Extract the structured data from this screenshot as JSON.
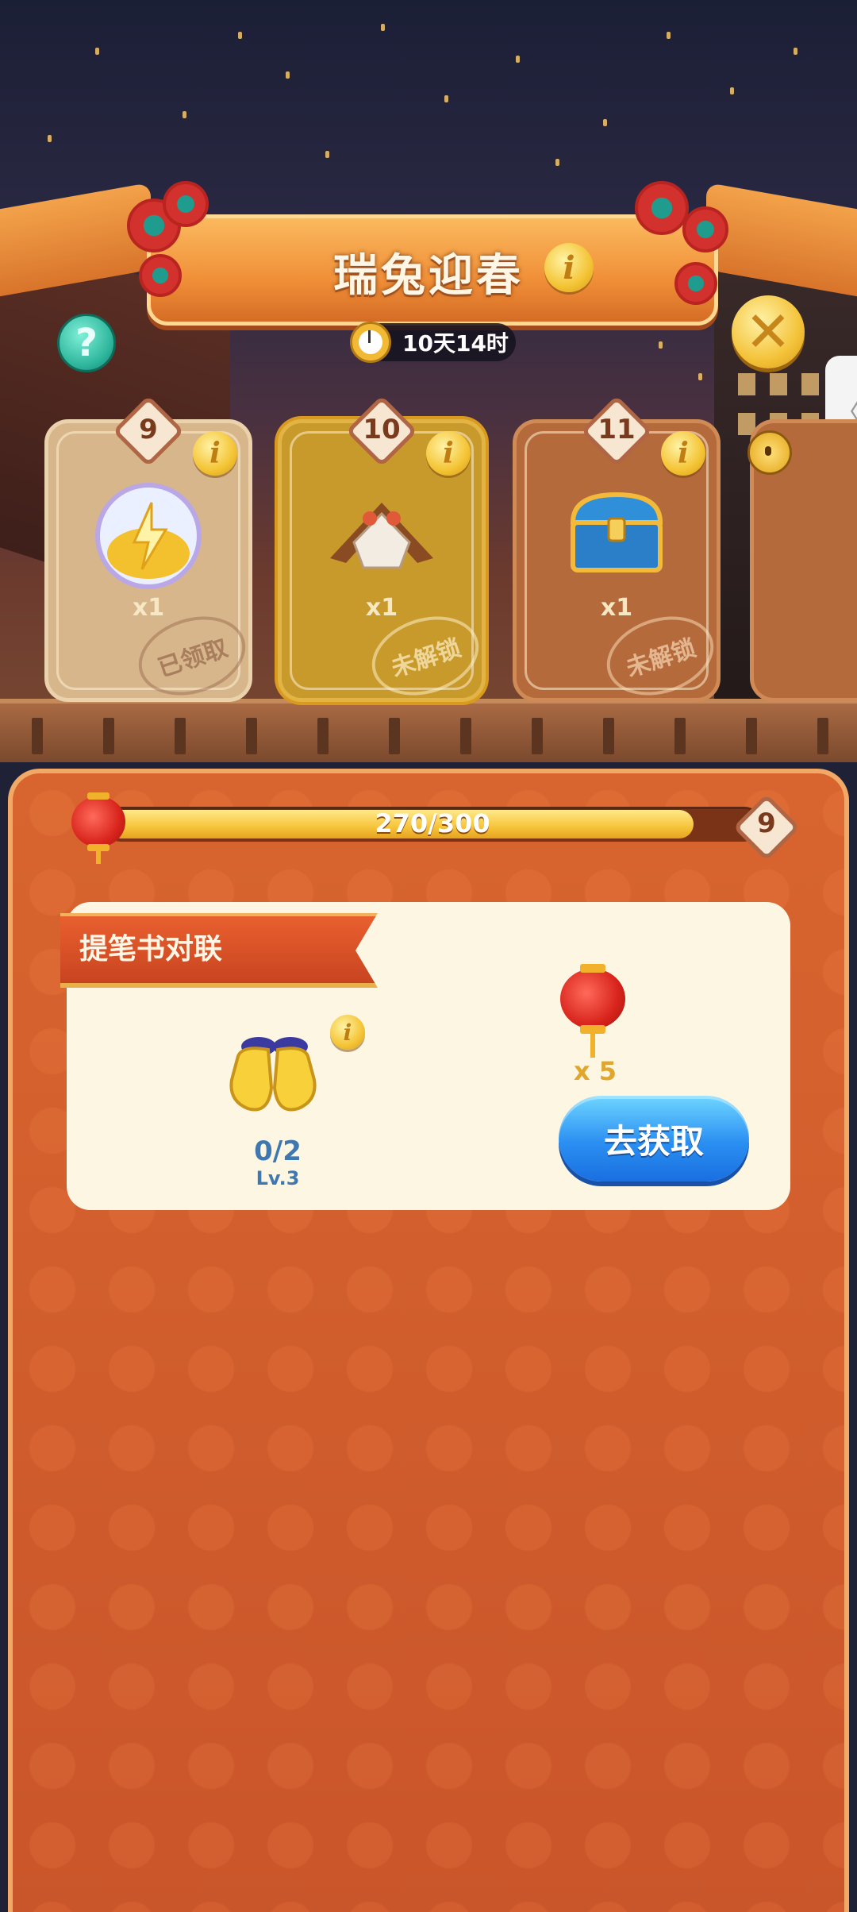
{
  "header": {
    "title": "瑞兔迎春",
    "timer": "10天14时"
  },
  "rewards": [
    {
      "level": "9",
      "quantity": "x1",
      "stamp": "已领取",
      "item_icon": "energy-orb-icon",
      "state": "claimed"
    },
    {
      "level": "10",
      "quantity": "x1",
      "stamp": "未解锁",
      "item_icon": "decor-tent-icon",
      "state": "locked-current"
    },
    {
      "level": "11",
      "quantity": "x1",
      "stamp": "未解锁",
      "item_icon": "treasure-chest-icon",
      "state": "locked"
    }
  ],
  "progress": {
    "text": "270/300",
    "current": 270,
    "max": 300,
    "target_level": "9"
  },
  "task": {
    "title": "提笔书对联",
    "progress": "0/2",
    "level": "Lv.3",
    "item_icon": "golden-gloves-icon",
    "reward_quantity": "x 5",
    "reward_icon": "red-lantern-icon",
    "button_label": "去获取"
  },
  "side_tab": {
    "icon": "chevron-left-icon",
    "glyph": "〈"
  },
  "colors": {
    "banner": "#f08f38",
    "panel": "#cf5d2e",
    "progress_fill": "#f6c43a",
    "button_blue": "#2a8ff2",
    "help_teal": "#2db59b"
  }
}
